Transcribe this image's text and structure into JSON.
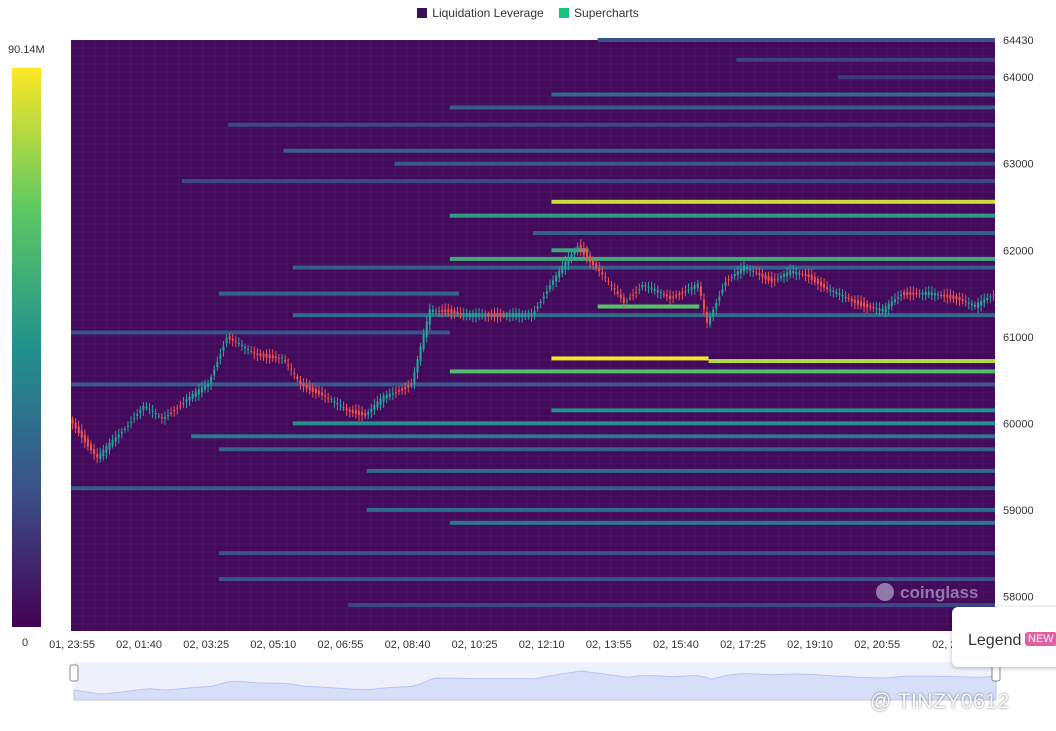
{
  "legend": {
    "items": [
      {
        "label": "Liquidation Leverage",
        "color": "#3b0f55"
      },
      {
        "label": "Supercharts",
        "color": "#19c37d"
      }
    ]
  },
  "colorbar": {
    "max_label": "90.14M",
    "min_label": "0"
  },
  "brand": {
    "logo_text": "coinglass"
  },
  "legend_button": {
    "label": "Legend",
    "badge": "NEW"
  },
  "watermark": {
    "credit": "@ TINZY0612"
  },
  "chart_data": {
    "type": "heatmap",
    "title": "",
    "y_axis": {
      "ticks": [
        58000,
        59000,
        60000,
        61000,
        62000,
        63000,
        64000,
        64430
      ],
      "range": [
        57600,
        64430
      ]
    },
    "x_axis": {
      "tick_labels": [
        "01, 23:55",
        "02, 01:40",
        "02, 03:25",
        "02, 05:10",
        "02, 06:55",
        "02, 08:40",
        "02, 10:25",
        "02, 12:10",
        "02, 13:55",
        "02, 15:40",
        "02, 17:25",
        "02, 19:10",
        "02, 20:55",
        "02, 2"
      ]
    },
    "colorscale": [
      "#440154",
      "#3b528b",
      "#21918c",
      "#5ec962",
      "#fde725"
    ],
    "value_range": [
      0,
      90.14
    ],
    "value_unit": "M",
    "liquidation_bands": [
      {
        "price": 64430,
        "t_start": 0.57,
        "t_end": 1.0,
        "level": 0.25
      },
      {
        "price": 64200,
        "t_start": 0.72,
        "t_end": 1.0,
        "level": 0.2
      },
      {
        "price": 64000,
        "t_start": 0.83,
        "t_end": 1.0,
        "level": 0.18
      },
      {
        "price": 63800,
        "t_start": 0.52,
        "t_end": 1.0,
        "level": 0.35
      },
      {
        "price": 63650,
        "t_start": 0.41,
        "t_end": 1.0,
        "level": 0.3
      },
      {
        "price": 63450,
        "t_start": 0.17,
        "t_end": 1.0,
        "level": 0.22
      },
      {
        "price": 63150,
        "t_start": 0.23,
        "t_end": 1.0,
        "level": 0.3
      },
      {
        "price": 63000,
        "t_start": 0.35,
        "t_end": 1.0,
        "level": 0.28
      },
      {
        "price": 62800,
        "t_start": 0.12,
        "t_end": 1.0,
        "level": 0.22
      },
      {
        "price": 62560,
        "t_start": 0.52,
        "t_end": 1.0,
        "level": 0.92
      },
      {
        "price": 62400,
        "t_start": 0.41,
        "t_end": 1.0,
        "level": 0.55
      },
      {
        "price": 62200,
        "t_start": 0.5,
        "t_end": 1.0,
        "level": 0.3
      },
      {
        "price": 62000,
        "t_start": 0.52,
        "t_end": 0.56,
        "level": 0.6
      },
      {
        "price": 61900,
        "t_start": 0.41,
        "t_end": 1.0,
        "level": 0.62
      },
      {
        "price": 61800,
        "t_start": 0.24,
        "t_end": 1.0,
        "level": 0.3
      },
      {
        "price": 61500,
        "t_start": 0.16,
        "t_end": 0.42,
        "level": 0.32
      },
      {
        "price": 61350,
        "t_start": 0.57,
        "t_end": 0.68,
        "level": 0.72
      },
      {
        "price": 61250,
        "t_start": 0.24,
        "t_end": 1.0,
        "level": 0.35
      },
      {
        "price": 61050,
        "t_start": 0.0,
        "t_end": 0.41,
        "level": 0.25
      },
      {
        "price": 60750,
        "t_start": 0.52,
        "t_end": 0.69,
        "level": 0.98
      },
      {
        "price": 60720,
        "t_start": 0.69,
        "t_end": 1.0,
        "level": 0.88
      },
      {
        "price": 60600,
        "t_start": 0.41,
        "t_end": 1.0,
        "level": 0.7
      },
      {
        "price": 60450,
        "t_start": 0.0,
        "t_end": 1.0,
        "level": 0.28
      },
      {
        "price": 60150,
        "t_start": 0.52,
        "t_end": 1.0,
        "level": 0.5
      },
      {
        "price": 60000,
        "t_start": 0.24,
        "t_end": 1.0,
        "level": 0.5
      },
      {
        "price": 59850,
        "t_start": 0.13,
        "t_end": 1.0,
        "level": 0.4
      },
      {
        "price": 59700,
        "t_start": 0.16,
        "t_end": 1.0,
        "level": 0.32
      },
      {
        "price": 59450,
        "t_start": 0.32,
        "t_end": 1.0,
        "level": 0.35
      },
      {
        "price": 59250,
        "t_start": 0.0,
        "t_end": 1.0,
        "level": 0.3
      },
      {
        "price": 59000,
        "t_start": 0.32,
        "t_end": 1.0,
        "level": 0.35
      },
      {
        "price": 58850,
        "t_start": 0.41,
        "t_end": 1.0,
        "level": 0.4
      },
      {
        "price": 58500,
        "t_start": 0.16,
        "t_end": 1.0,
        "level": 0.25
      },
      {
        "price": 58200,
        "t_start": 0.16,
        "t_end": 1.0,
        "level": 0.25
      },
      {
        "price": 57900,
        "t_start": 0.3,
        "t_end": 1.0,
        "level": 0.22
      }
    ],
    "price_series": {
      "t": [
        0.0,
        0.03,
        0.06,
        0.08,
        0.1,
        0.13,
        0.15,
        0.17,
        0.2,
        0.23,
        0.25,
        0.27,
        0.3,
        0.32,
        0.34,
        0.37,
        0.39,
        0.41,
        0.43,
        0.45,
        0.47,
        0.5,
        0.52,
        0.54,
        0.55,
        0.57,
        0.6,
        0.62,
        0.65,
        0.68,
        0.69,
        0.71,
        0.73,
        0.76,
        0.78,
        0.8,
        0.82,
        0.85,
        0.88,
        0.9,
        0.93,
        0.96,
        0.98,
        1.0
      ],
      "price": [
        60050,
        59600,
        59950,
        60200,
        60050,
        60300,
        60450,
        61000,
        60800,
        60750,
        60450,
        60350,
        60150,
        60100,
        60300,
        60450,
        61300,
        61300,
        61250,
        61250,
        61250,
        61250,
        61600,
        61900,
        62050,
        61800,
        61400,
        61600,
        61450,
        61600,
        61150,
        61650,
        61800,
        61650,
        61750,
        61700,
        61550,
        61400,
        61300,
        61500,
        61500,
        61450,
        61350,
        61500
      ]
    }
  },
  "colors": {
    "heat_background": "#43095b",
    "price_up": "#26a69a",
    "price_down": "#ef5350",
    "navigator_fill": "#d7def7"
  }
}
